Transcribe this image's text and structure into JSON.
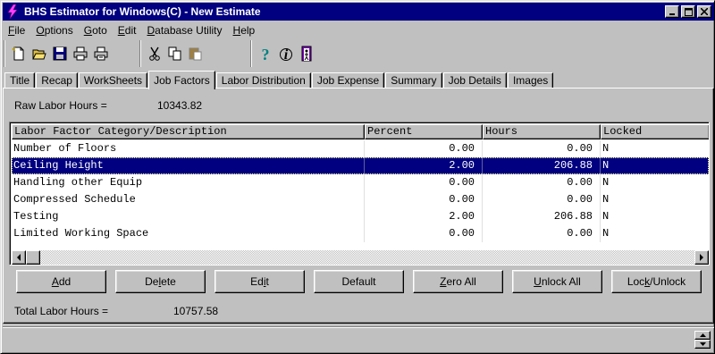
{
  "window": {
    "title": "BHS Estimator for Windows(C) - New Estimate"
  },
  "menu": [
    {
      "label": "File",
      "accel": "F"
    },
    {
      "label": "Options",
      "accel": "O"
    },
    {
      "label": "Goto",
      "accel": "G"
    },
    {
      "label": "Edit",
      "accel": "E"
    },
    {
      "label": "Database Utility",
      "accel": "D"
    },
    {
      "label": "Help",
      "accel": "H"
    }
  ],
  "tabs": [
    "Title",
    "Recap",
    "WorkSheets",
    "Job Factors",
    "Labor Distribution",
    "Job Expense",
    "Summary",
    "Job Details",
    "Images"
  ],
  "active_tab": "Job Factors",
  "raw_labor": {
    "label": "Raw Labor Hours =",
    "value": "10343.82"
  },
  "grid": {
    "columns": [
      "Labor Factor Category/Description",
      "Percent",
      "Hours",
      "Locked"
    ],
    "rows": [
      {
        "desc": "Number of Floors",
        "percent": "0.00",
        "hours": "0.00",
        "locked": "N"
      },
      {
        "desc": "Ceiling Height",
        "percent": "2.00",
        "hours": "206.88",
        "locked": "N",
        "selected": true
      },
      {
        "desc": "Handling other Equip",
        "percent": "0.00",
        "hours": "0.00",
        "locked": "N"
      },
      {
        "desc": "Compressed Schedule",
        "percent": "0.00",
        "hours": "0.00",
        "locked": "N"
      },
      {
        "desc": "Testing",
        "percent": "2.00",
        "hours": "206.88",
        "locked": "N"
      },
      {
        "desc": "Limited Working Space",
        "percent": "0.00",
        "hours": "0.00",
        "locked": "N"
      }
    ]
  },
  "buttons": {
    "add": "Add",
    "delete": "Delete",
    "edit": "Edit",
    "default": "Default",
    "zero_all": "Zero All",
    "unlock_all": "Unlock All",
    "lock_unlock": "Lock/Unlock"
  },
  "total_labor": {
    "label": "Total Labor Hours =",
    "value": "10757.58"
  },
  "colors": {
    "title_bg": "#000080",
    "face": "#c0c0c0",
    "selection": "#000080"
  }
}
